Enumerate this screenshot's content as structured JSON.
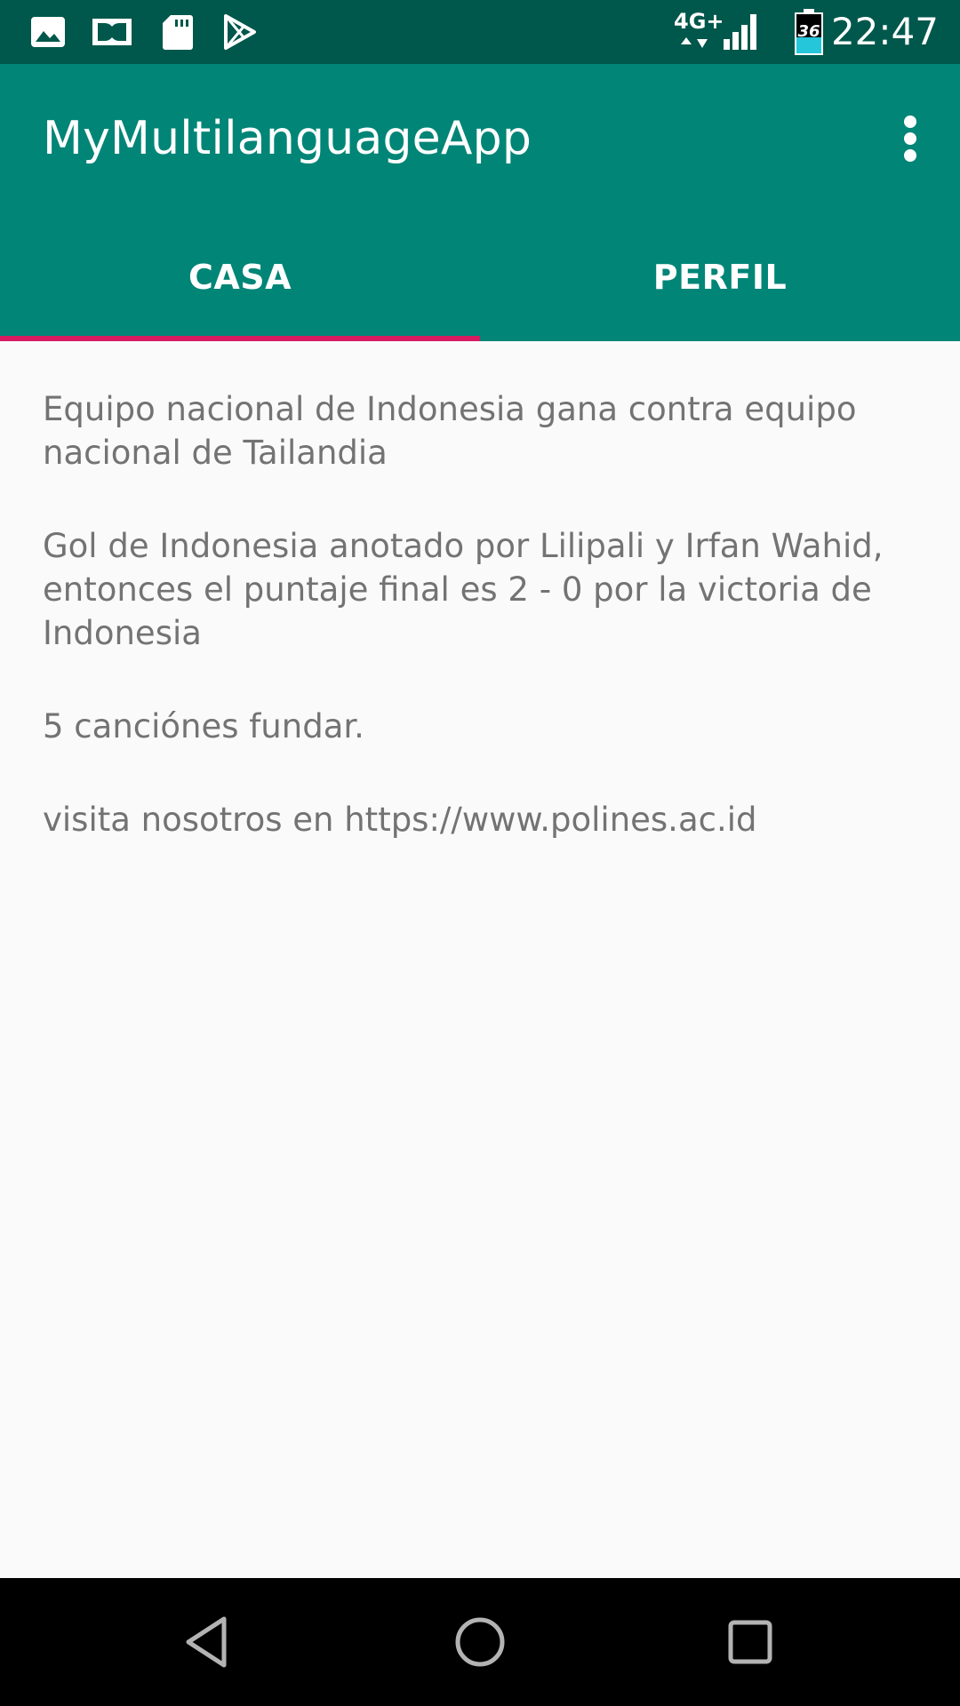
{
  "status_bar": {
    "time": "22:47",
    "network_label": "4G+",
    "battery_level": "36",
    "left_icons": [
      "image-icon",
      "dolby-icon",
      "sd-card-icon",
      "play-store-icon"
    ],
    "right_icons": [
      "network-4g-icon",
      "signal-icon",
      "battery-icon"
    ]
  },
  "app_bar": {
    "title": "MyMultilanguageApp",
    "menu_icon": "more-vert-icon"
  },
  "tabs": [
    {
      "label": "CASA",
      "selected": true
    },
    {
      "label": "PERFIL",
      "selected": false
    }
  ],
  "content": {
    "paragraphs": [
      "Equipo nacional de Indonesia gana contra equipo nacional de Tailandia",
      "Gol de Indonesia anotado por Lilipali y Irfan Wahid, entonces el puntaje final es 2 - 0 por la victoria de Indonesia",
      "5 canciónes fundar.",
      "visita nosotros en https://www.polines.ac.id"
    ]
  },
  "nav_bar": {
    "buttons": [
      "back-icon",
      "home-icon",
      "recents-icon"
    ]
  },
  "colors": {
    "status_bar": "#00574b",
    "primary": "#008577",
    "accent": "#d81b60",
    "background": "#fafafa",
    "text": "#737373"
  }
}
